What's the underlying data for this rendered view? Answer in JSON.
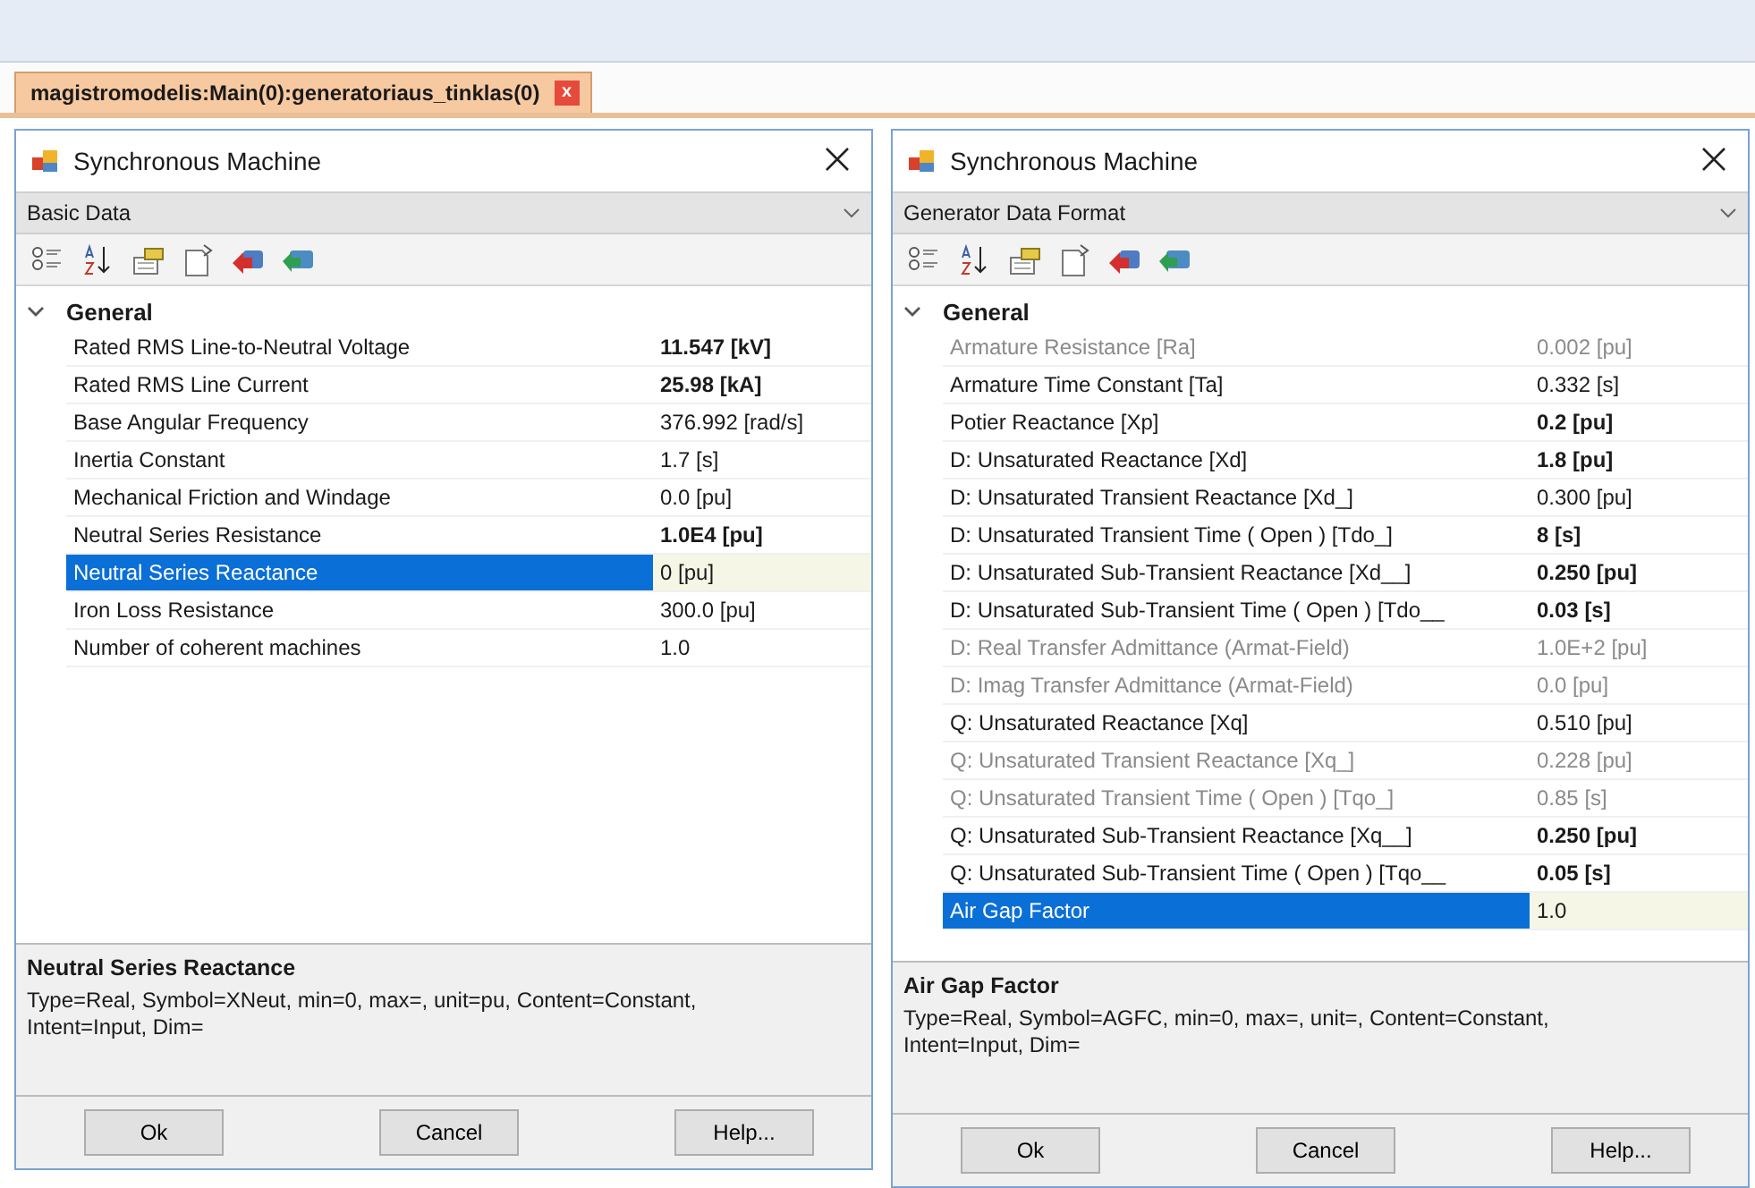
{
  "document_tab": {
    "label": "magistromodelis:Main(0):generatoriaus_tinklas(0)",
    "close": "x"
  },
  "dialogs": [
    {
      "title": "Synchronous Machine",
      "page_select": "Basic Data",
      "group": {
        "label": "General",
        "expanded": true
      },
      "rows": [
        {
          "name": "Rated RMS Line-to-Neutral Voltage",
          "value": "11.547 [kV]",
          "bold": true,
          "disabled": false,
          "selected": false
        },
        {
          "name": "Rated RMS Line Current",
          "value": "25.98 [kA]",
          "bold": true,
          "disabled": false,
          "selected": false
        },
        {
          "name": "Base Angular Frequency",
          "value": "376.992 [rad/s]",
          "bold": false,
          "disabled": false,
          "selected": false
        },
        {
          "name": "Inertia Constant",
          "value": "1.7 [s]",
          "bold": false,
          "disabled": false,
          "selected": false
        },
        {
          "name": "Mechanical Friction and Windage",
          "value": "0.0 [pu]",
          "bold": false,
          "disabled": false,
          "selected": false
        },
        {
          "name": "Neutral Series Resistance",
          "value": "1.0E4 [pu]",
          "bold": true,
          "disabled": false,
          "selected": false
        },
        {
          "name": "Neutral Series Reactance",
          "value": "0 [pu]",
          "bold": false,
          "disabled": false,
          "selected": true
        },
        {
          "name": "Iron Loss Resistance",
          "value": "300.0 [pu]",
          "bold": false,
          "disabled": false,
          "selected": false
        },
        {
          "name": "Number of coherent machines",
          "value": "1.0",
          "bold": false,
          "disabled": false,
          "selected": false
        }
      ],
      "help_title": "Neutral Series Reactance",
      "help_text": "Type=Real, Symbol=XNeut, min=0, max=, unit=pu, Content=Constant, Intent=Input, Dim=",
      "buttons": [
        "Ok",
        "Cancel",
        "Help..."
      ]
    },
    {
      "title": "Synchronous Machine",
      "page_select": "Generator Data Format",
      "group": {
        "label": "General",
        "expanded": true
      },
      "rows": [
        {
          "name": "Armature Resistance [Ra]",
          "value": "0.002 [pu]",
          "bold": false,
          "disabled": true,
          "selected": false
        },
        {
          "name": "Armature Time Constant [Ta]",
          "value": "0.332 [s]",
          "bold": false,
          "disabled": false,
          "selected": false
        },
        {
          "name": "Potier Reactance [Xp]",
          "value": "0.2 [pu]",
          "bold": true,
          "disabled": false,
          "selected": false
        },
        {
          "name": "D: Unsaturated Reactance [Xd]",
          "value": "1.8 [pu]",
          "bold": true,
          "disabled": false,
          "selected": false
        },
        {
          "name": "D: Unsaturated Transient Reactance [Xd_]",
          "value": "0.300 [pu]",
          "bold": false,
          "disabled": false,
          "selected": false
        },
        {
          "name": "D: Unsaturated Transient Time  ( Open ) [Tdo_]",
          "value": "8 [s]",
          "bold": true,
          "disabled": false,
          "selected": false
        },
        {
          "name": "D: Unsaturated Sub-Transient Reactance [Xd__]",
          "value": "0.250 [pu]",
          "bold": true,
          "disabled": false,
          "selected": false
        },
        {
          "name": "D: Unsaturated Sub-Transient Time ( Open ) [Tdo__",
          "value": "0.03 [s]",
          "bold": true,
          "disabled": false,
          "selected": false
        },
        {
          "name": "D: Real Transfer Admittance (Armat-Field)",
          "value": "1.0E+2 [pu]",
          "bold": false,
          "disabled": true,
          "selected": false
        },
        {
          "name": "D: Imag Transfer Admittance (Armat-Field)",
          "value": "0.0 [pu]",
          "bold": false,
          "disabled": true,
          "selected": false
        },
        {
          "name": "Q: Unsaturated Reactance [Xq]",
          "value": "0.510 [pu]",
          "bold": false,
          "disabled": false,
          "selected": false
        },
        {
          "name": "Q: Unsaturated Transient Reactance [Xq_]",
          "value": "0.228 [pu]",
          "bold": false,
          "disabled": true,
          "selected": false
        },
        {
          "name": "Q: Unsaturated Transient Time  ( Open ) [Tqo_]",
          "value": "0.85 [s]",
          "bold": false,
          "disabled": true,
          "selected": false
        },
        {
          "name": "Q: Unsaturated Sub-Transient Reactance [Xq__]",
          "value": "0.250 [pu]",
          "bold": true,
          "disabled": false,
          "selected": false
        },
        {
          "name": "Q: Unsaturated Sub-Transient Time ( Open ) [Tqo__",
          "value": "0.05 [s]",
          "bold": true,
          "disabled": false,
          "selected": false
        },
        {
          "name": "Air Gap Factor",
          "value": "1.0",
          "bold": false,
          "disabled": false,
          "selected": true
        }
      ],
      "help_title": "Air Gap Factor",
      "help_text": "Type=Real, Symbol=AGFC, min=0, max=, unit=, Content=Constant, Intent=Input, Dim=",
      "buttons": [
        "Ok",
        "Cancel",
        "Help..."
      ]
    }
  ]
}
